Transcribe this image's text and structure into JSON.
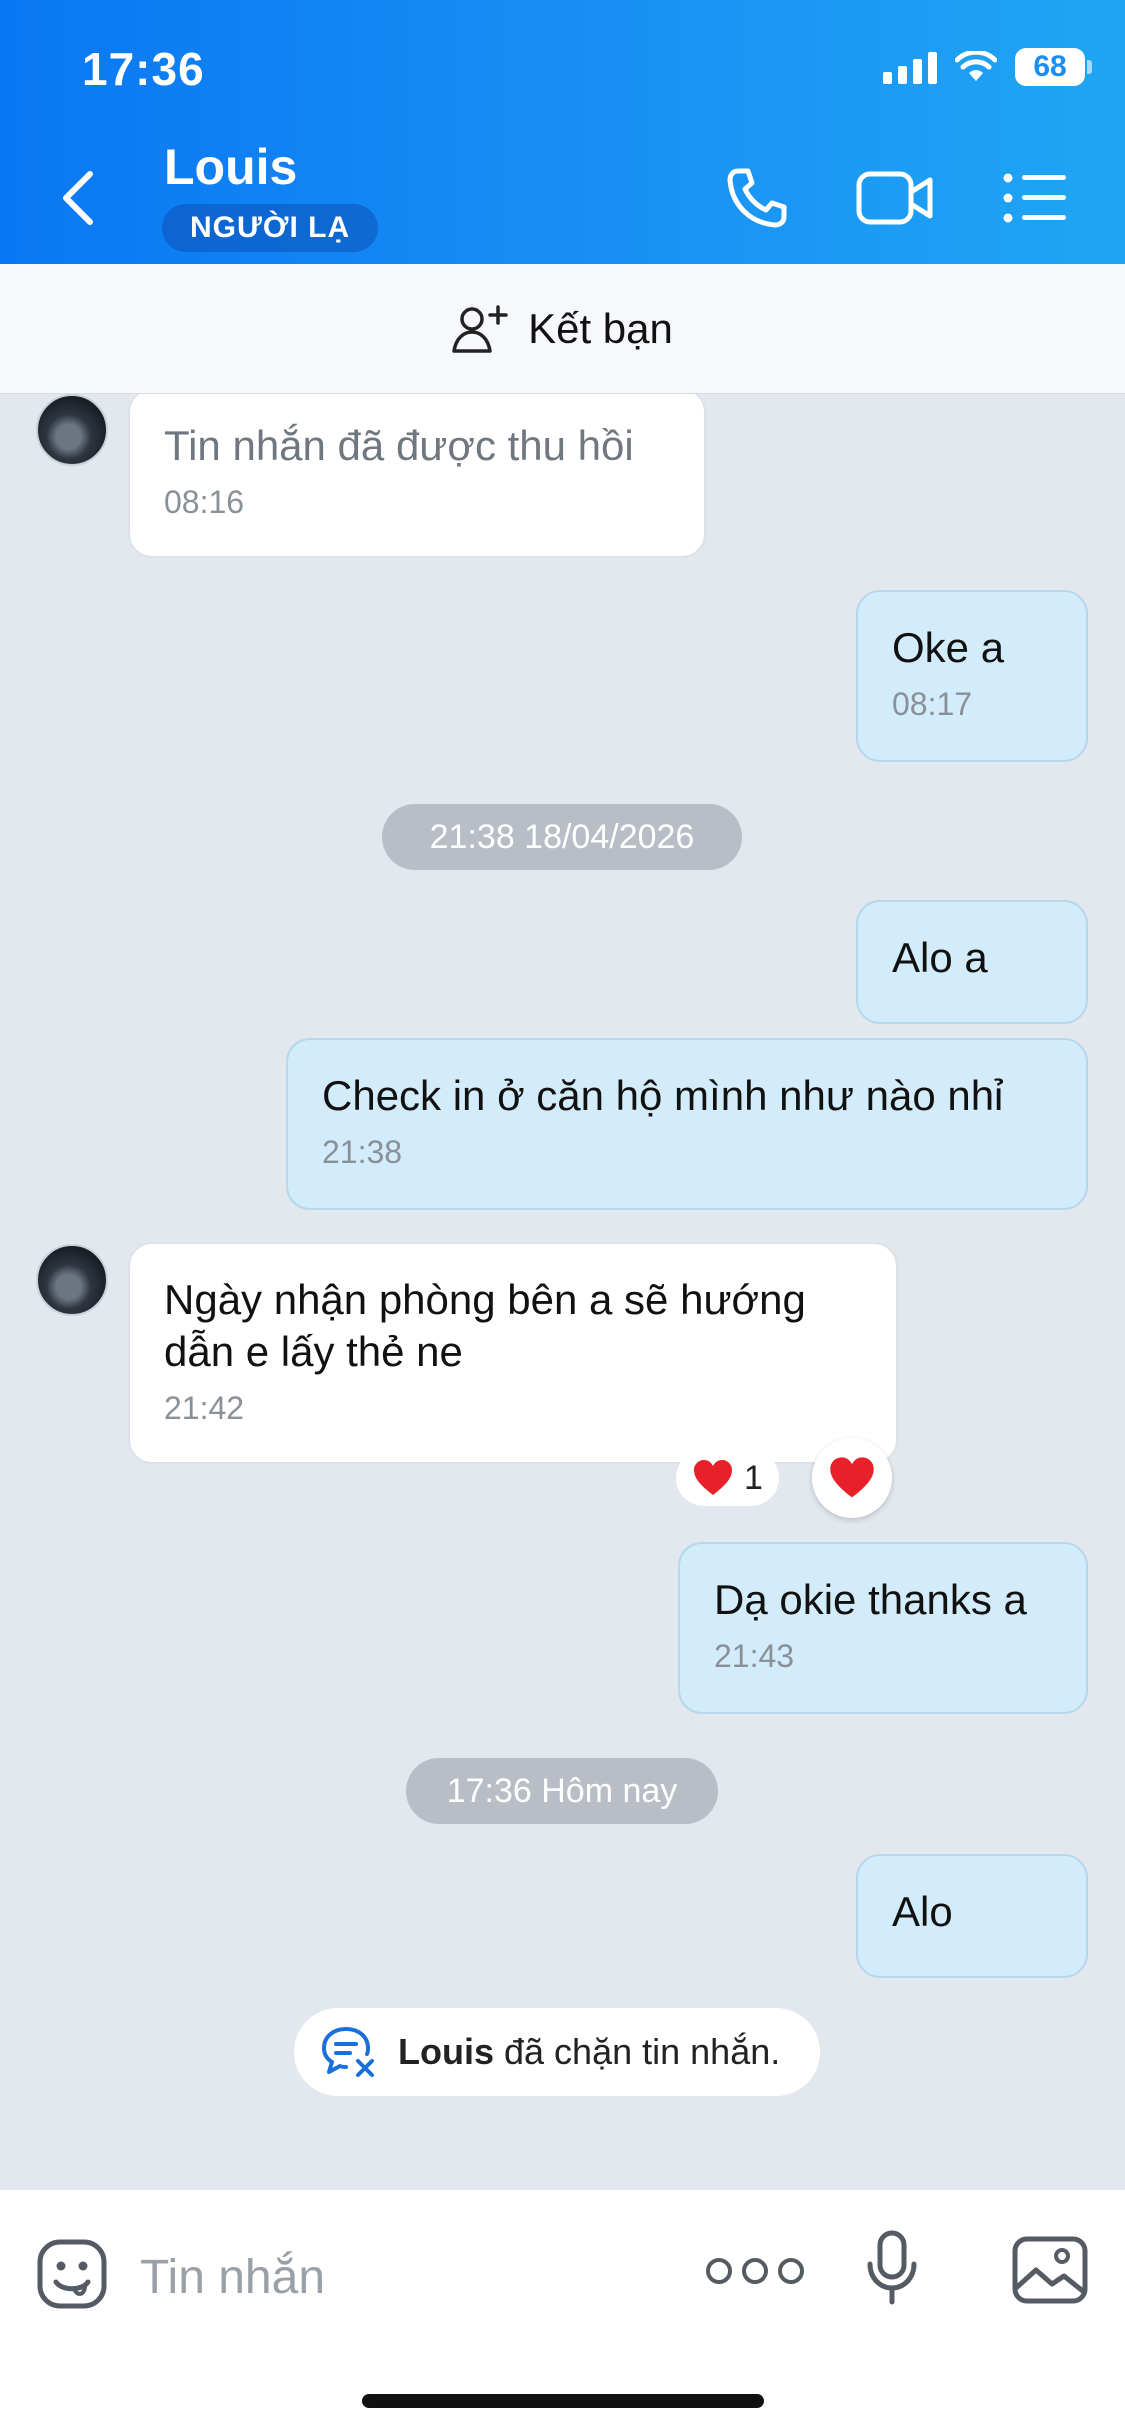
{
  "status_bar": {
    "time": "17:36",
    "battery": "68"
  },
  "header": {
    "contact_name": "Louis",
    "badge": "NGƯỜI LẠ"
  },
  "add_friend": {
    "label": "Kết bạn"
  },
  "messages": [
    {
      "text": "Tin nhắn đã được thu hồi",
      "time": "08:16"
    },
    {
      "text": "Oke a",
      "time": "08:17"
    },
    {
      "divider": "21:38 18/04/2026"
    },
    {
      "text": "Alo a"
    },
    {
      "text": "Check in ở căn hộ mình như nào nhỉ",
      "time": "21:38"
    },
    {
      "text": "Ngày nhận phòng bên a sẽ hướng dẫn e lấy thẻ ne",
      "time": "21:42",
      "reaction_count": "1"
    },
    {
      "text": "Dạ okie thanks a",
      "time": "21:43"
    },
    {
      "divider": "17:36 Hôm nay"
    },
    {
      "text": "Alo"
    }
  ],
  "notice": {
    "name": "Louis",
    "text": "đã chặn tin nhắn."
  },
  "composer": {
    "placeholder": "Tin nhắn"
  },
  "colors": {
    "header_start": "#0a77f2",
    "header_end": "#1fa6f3",
    "outgoing_bubble": "#d3ecfb",
    "chat_bg": "#e3e8ef",
    "heart": "#e8202a"
  },
  "icons": [
    "back-icon",
    "phone-icon",
    "video-call-icon",
    "menu-list-icon",
    "add-friend-icon",
    "heart-icon",
    "blocked-chat-icon",
    "sticker-icon",
    "more-icon",
    "microphone-icon",
    "image-icon"
  ]
}
